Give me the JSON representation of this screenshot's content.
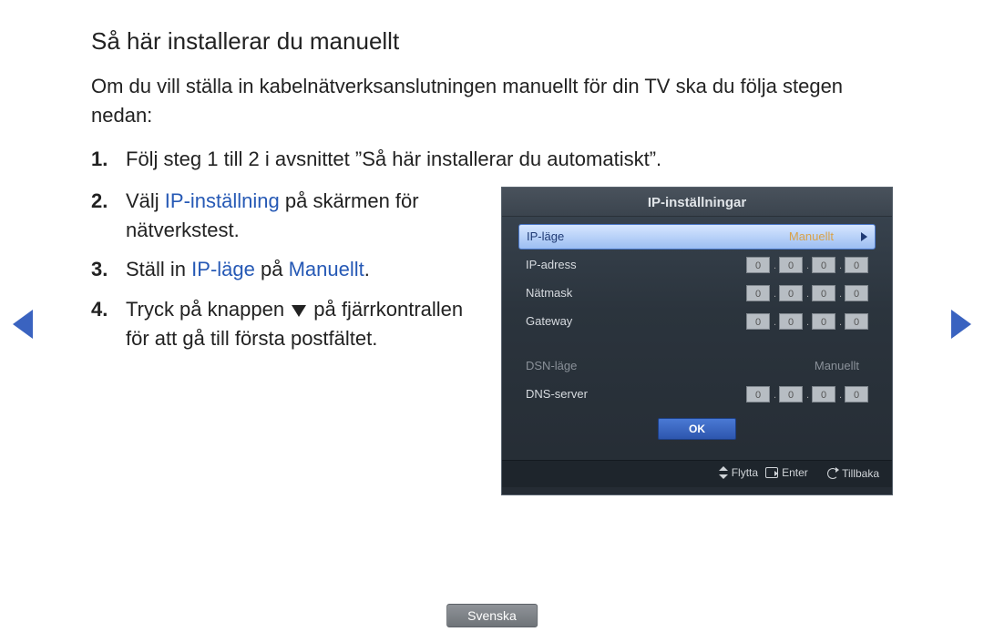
{
  "title": "Så här installerar du manuellt",
  "intro": "Om du vill ställa in kabelnätverksanslutningen manuellt för din TV ska du följa stegen nedan:",
  "steps": {
    "s1": "Följ steg 1 till 2 i avsnittet ”Så här installerar du automatiskt”.",
    "s2_a": "Välj ",
    "s2_hl": "IP-inställning",
    "s2_b": " på skärmen för nätverkstest.",
    "s3_a": "Ställ in ",
    "s3_hl1": "IP-läge",
    "s3_b": " på ",
    "s3_hl2": "Manuellt",
    "s3_c": ".",
    "s4_a": "Tryck på knappen ",
    "s4_b": " på fjärrkontrallen för att gå till första postfältet."
  },
  "panel": {
    "title": "IP-inställningar",
    "rows": {
      "ipmode_label": "IP-läge",
      "ipmode_value": "Manuellt",
      "ipaddr_label": "IP-adress",
      "netmask_label": "Nätmask",
      "gateway_label": "Gateway",
      "dsnmode_label": "DSN-läge",
      "dsnmode_value": "Manuellt",
      "dns_label": "DNS-server",
      "octet": "0"
    },
    "ok": "OK",
    "footer": {
      "move": "Flytta",
      "enter": "Enter",
      "return": "Tillbaka"
    }
  },
  "language": "Svenska"
}
